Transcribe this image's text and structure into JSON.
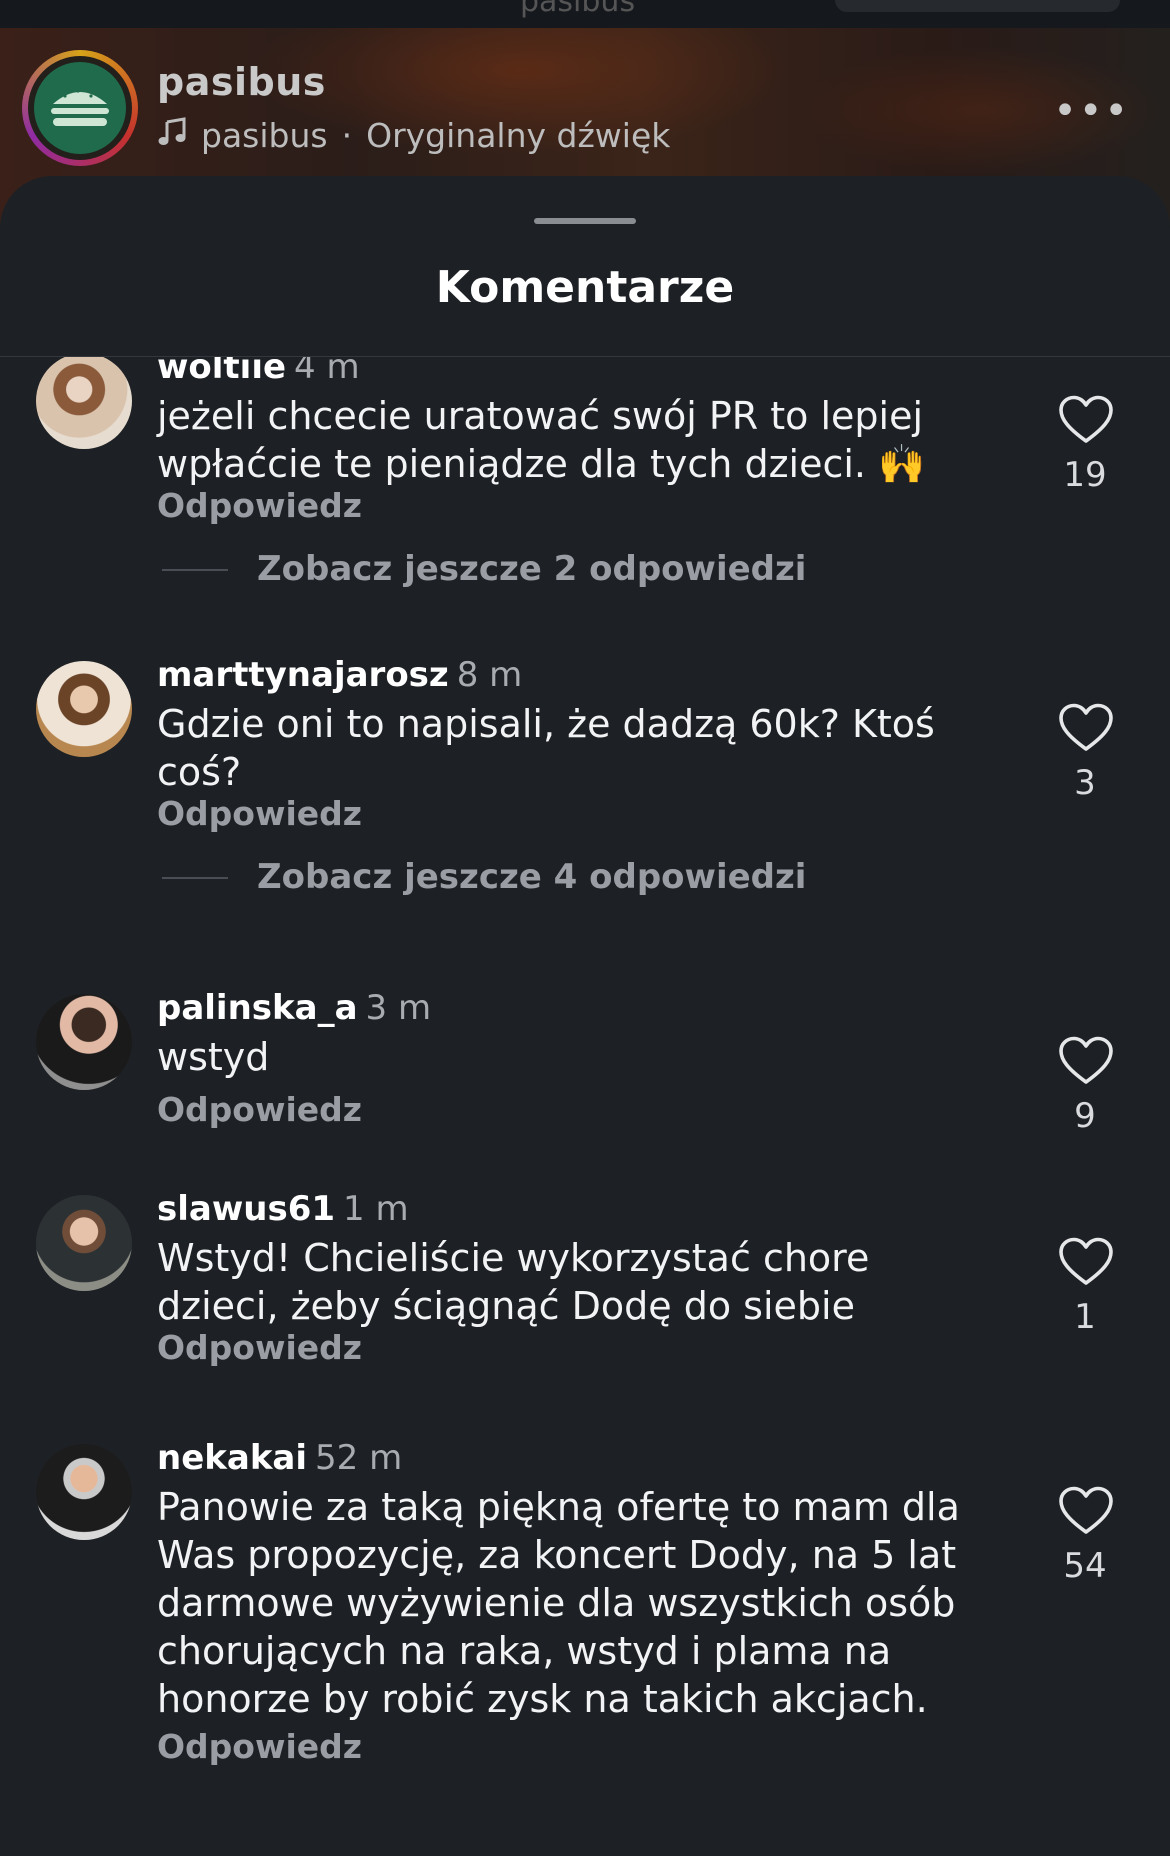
{
  "reel": {
    "top_title_ghost": "pasibus",
    "account_name": "pasibus",
    "audio_owner": "pasibus",
    "audio_separator": "·",
    "audio_label": "Oryginalny dźwięk",
    "more_glyph": "•••"
  },
  "sheet": {
    "title": "Komentarze"
  },
  "comments": [
    {
      "username": "woltiie",
      "time": "4 m",
      "text": "jeżeli chcecie uratować swój PR to lepiej wpłaćcie te pieniądze dla tych dzieci. 🙌",
      "reply_label": "Odpowiedz",
      "likes": "19",
      "more_replies": "Zobacz jeszcze 2 odpowiedzi"
    },
    {
      "username": "marttynajarosz",
      "time": "8 m",
      "text": "Gdzie oni to napisali, że dadzą 60k? Ktoś coś?",
      "reply_label": "Odpowiedz",
      "likes": "3",
      "more_replies": "Zobacz jeszcze 4 odpowiedzi"
    },
    {
      "username": "palinska_a",
      "time": "3 m",
      "text": "wstyd",
      "reply_label": "Odpowiedz",
      "likes": "9"
    },
    {
      "username": "slawus61",
      "time": "1 m",
      "text": "Wstyd! Chcieliście wykorzystać chore dzieci, żeby ściągnąć Dodę do siebie",
      "reply_label": "Odpowiedz",
      "likes": "1"
    },
    {
      "username": "nekakai",
      "time": "52 m",
      "text": "Panowie za taką piękną ofertę to mam dla Was propozycję, za koncert Dody, na 5 lat darmowe wyżywienie dla wszystkich osób chorujących na raka, wstyd i plama na honorze by robić zysk na takich akcjach.",
      "reply_label": "Odpowiedz",
      "likes": "54"
    }
  ],
  "colors": {
    "sheet_bg": "#1d2024",
    "secondary_text": "#9a9ea4",
    "primary_text": "#f2f3f5"
  },
  "icons": {
    "like": "heart-outline-icon",
    "audio": "music-note-icon",
    "more": "more-horizontal-icon"
  }
}
